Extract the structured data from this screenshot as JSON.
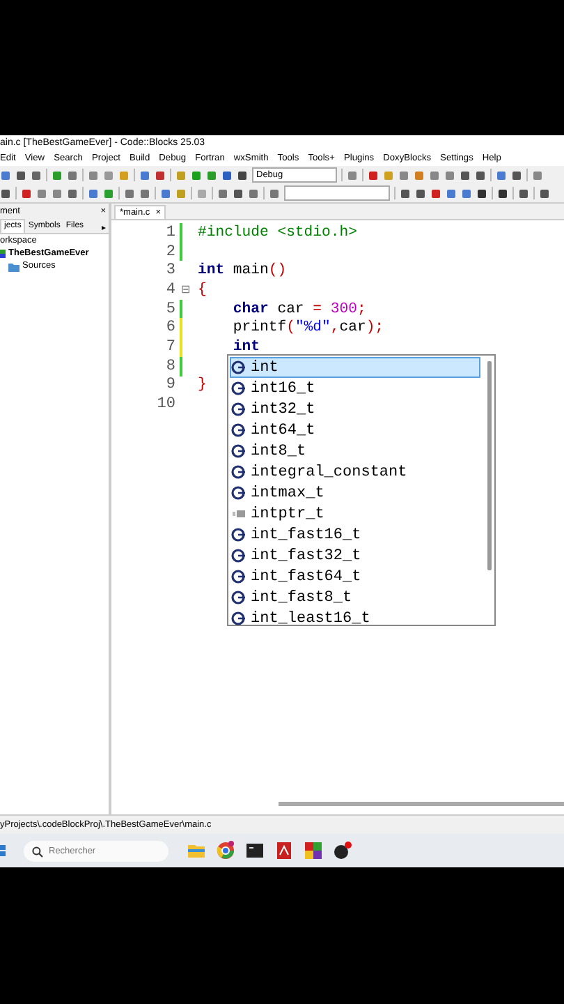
{
  "window": {
    "title": "ain.c [TheBestGameEver] - Code::Blocks 25.03"
  },
  "menu": [
    "Edit",
    "View",
    "Search",
    "Project",
    "Build",
    "Debug",
    "Fortran",
    "wxSmith",
    "Tools",
    "Tools+",
    "Plugins",
    "DoxyBlocks",
    "Settings",
    "Help"
  ],
  "toolbar": {
    "build_target": "Debug"
  },
  "sidebar": {
    "title": "ment",
    "close": "×",
    "tabs": [
      {
        "label": "jects",
        "selected": true
      },
      {
        "label": "Symbols",
        "selected": false
      },
      {
        "label": "Files",
        "selected": false
      }
    ],
    "more": "▸",
    "tree": [
      {
        "label": "orkspace",
        "kind": "workspace",
        "children": [
          {
            "label": "TheBestGameEver",
            "kind": "project",
            "children": [
              {
                "label": "Sources",
                "kind": "folder"
              }
            ]
          }
        ]
      }
    ]
  },
  "editor": {
    "tabs": [
      {
        "label": "*main.c",
        "close": "×",
        "selected": true
      }
    ],
    "lines": [
      {
        "number": "1",
        "color": "#3ccc3c",
        "tokens": [
          {
            "text": "#include <stdio.h>",
            "kind": "preprocessor"
          }
        ]
      },
      {
        "number": "2",
        "color": "#3ccc3c"
      },
      {
        "number": "3",
        "tokens": [
          {
            "text": "int",
            "kind": "keyword"
          },
          {
            "text": " main",
            "kind": "plain"
          },
          {
            "text": "()",
            "kind": "operator"
          }
        ]
      },
      {
        "number": "4",
        "fold": "⊟",
        "tokens": [
          {
            "text": "{",
            "kind": "operator"
          }
        ]
      },
      {
        "number": "5",
        "color": "#3ccc3c",
        "tokens": [
          {
            "text": "    char",
            "kind": "keyword"
          },
          {
            "text": " car ",
            "kind": "plain"
          },
          {
            "text": "=",
            "kind": "operator"
          },
          {
            "text": " 300",
            "kind": "number"
          },
          {
            "text": ";",
            "kind": "operator"
          }
        ]
      },
      {
        "number": "6",
        "color": "#e8e020",
        "tokens": [
          {
            "text": "    printf",
            "kind": "plain"
          },
          {
            "text": "(",
            "kind": "operator"
          },
          {
            "text": "\"%d\"",
            "kind": "string"
          },
          {
            "text": ",",
            "kind": "operator"
          },
          {
            "text": "car",
            "kind": "plain"
          },
          {
            "text": ");",
            "kind": "operator"
          }
        ]
      },
      {
        "number": "7",
        "color": "#e8e020",
        "tokens": [
          {
            "text": "    int",
            "kind": "keyword"
          }
        ]
      },
      {
        "number": "8",
        "color": "#3ccc3c"
      },
      {
        "number": "9",
        "tokens": [
          {
            "text": "}",
            "kind": "operator"
          }
        ]
      },
      {
        "number": "10"
      }
    ],
    "completion": [
      {
        "label": "int",
        "kind": "class",
        "selected": true
      },
      {
        "label": "int16_t",
        "kind": "class",
        "selected": false
      },
      {
        "label": "int32_t",
        "kind": "class",
        "selected": false
      },
      {
        "label": "int64_t",
        "kind": "class",
        "selected": false
      },
      {
        "label": "int8_t",
        "kind": "class",
        "selected": false
      },
      {
        "label": "integral_constant",
        "kind": "class",
        "selected": false
      },
      {
        "label": "intmax_t",
        "kind": "class",
        "selected": false
      },
      {
        "label": "intptr_t",
        "kind": "typedef",
        "selected": false
      },
      {
        "label": "int_fast16_t",
        "kind": "class",
        "selected": false
      },
      {
        "label": "int_fast32_t",
        "kind": "class",
        "selected": false
      },
      {
        "label": "int_fast64_t",
        "kind": "class",
        "selected": false
      },
      {
        "label": "int_fast8_t",
        "kind": "class",
        "selected": false
      },
      {
        "label": "int_least16_t",
        "kind": "class",
        "selected": false
      }
    ]
  },
  "status_bar": {
    "path": "yProjects\\.codeBlockProj\\.TheBestGameEver\\main.c"
  },
  "taskbar": {
    "search": {
      "placeholder": "Rechercher"
    }
  }
}
